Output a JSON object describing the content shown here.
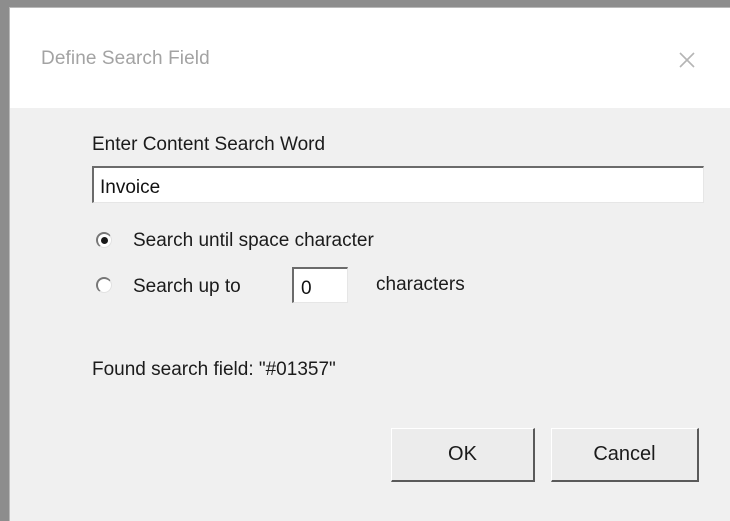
{
  "dialog": {
    "title": "Define Search Field",
    "close_icon": "close-icon"
  },
  "search_word": {
    "label": "Enter Content Search Word",
    "value": "Invoice"
  },
  "options": {
    "selected": "search-until-space",
    "search_until_space_label": "Search until space character",
    "search_up_to_label": "Search up to",
    "characters_value": "0",
    "characters_label": "characters"
  },
  "result": {
    "found_text": "Found search field: \"#01357\""
  },
  "buttons": {
    "ok_label": "OK",
    "cancel_label": "Cancel"
  }
}
